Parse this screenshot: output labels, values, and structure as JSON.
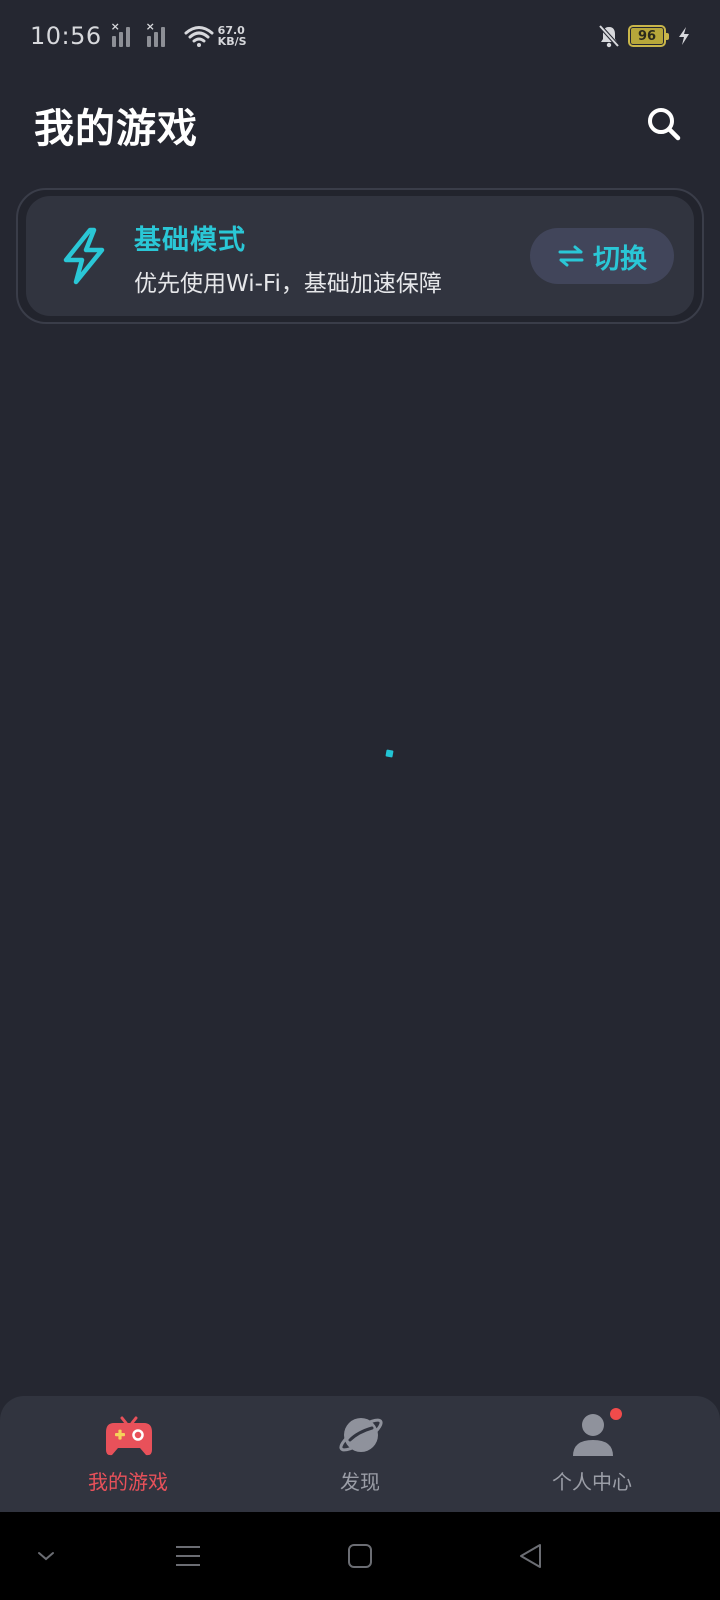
{
  "status_bar": {
    "time": "10:56",
    "net_speed_value": "67.0",
    "net_speed_unit": "KB/S",
    "battery_level": "96"
  },
  "header": {
    "title": "我的游戏",
    "search_icon": "search-icon"
  },
  "mode_card": {
    "title": "基础模式",
    "description": "优先使用Wi-Fi，基础加速保障",
    "switch_label": "切换",
    "icon": "lightning-icon"
  },
  "bottom_nav": {
    "items": [
      {
        "label": "我的游戏",
        "icon": "gamepad-icon",
        "active": true
      },
      {
        "label": "发现",
        "icon": "planet-icon",
        "active": false
      },
      {
        "label": "个人中心",
        "icon": "user-icon",
        "active": false
      }
    ]
  },
  "colors": {
    "background": "#252731",
    "card": "#31343f",
    "accent": "#2ac7d6",
    "active_nav": "#e8515a",
    "inactive_nav": "#9b9ea7"
  }
}
